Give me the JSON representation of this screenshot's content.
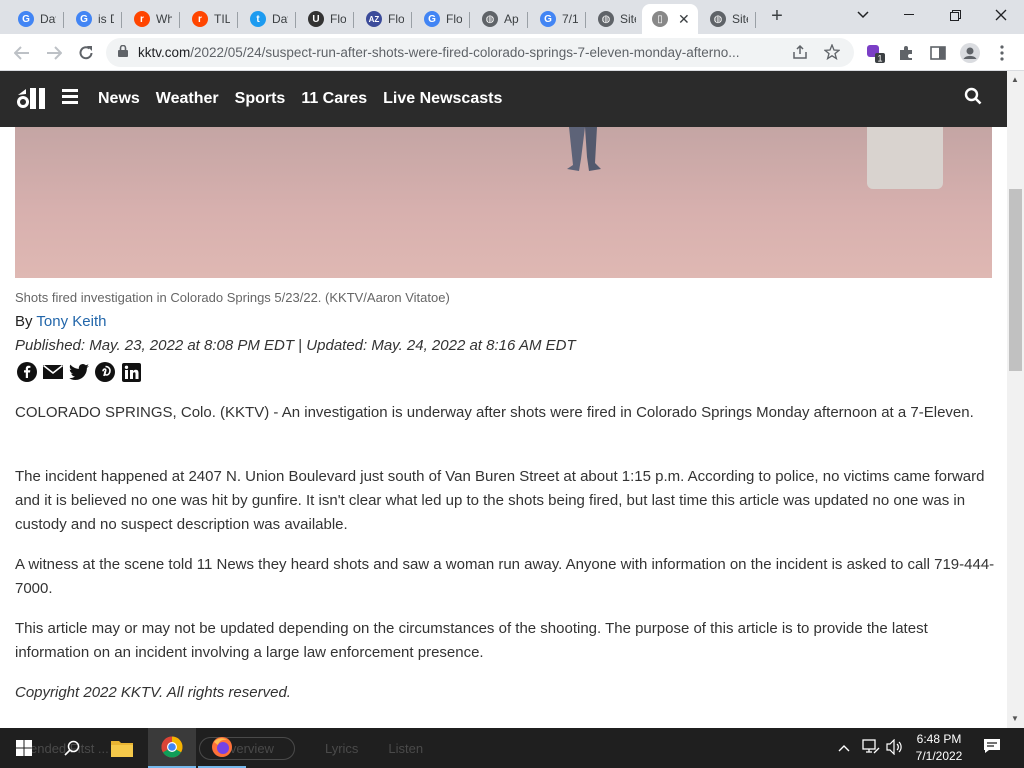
{
  "browser": {
    "tabs": [
      {
        "icon": "google-icon",
        "title": "Dav",
        "color": "#4285f4",
        "glyph": "G"
      },
      {
        "icon": "google-icon",
        "title": "is D",
        "color": "#4285f4",
        "glyph": "G"
      },
      {
        "icon": "reddit-icon",
        "title": "Wh",
        "color": "#ff4500",
        "glyph": "r"
      },
      {
        "icon": "reddit-icon",
        "title": "TIL",
        "color": "#ff4500",
        "glyph": "r"
      },
      {
        "icon": "twitter-icon",
        "title": "Dav",
        "color": "#1d9bf0",
        "glyph": "t"
      },
      {
        "icon": "flo-icon",
        "title": "Flo",
        "color": "#333333",
        "glyph": "U"
      },
      {
        "icon": "az-icon",
        "title": "Flo",
        "color": "#3b4b9a",
        "glyph": "AZ"
      },
      {
        "icon": "google-icon",
        "title": "Flo",
        "color": "#4285f4",
        "glyph": "G"
      },
      {
        "icon": "globe-icon",
        "title": "Ap",
        "color": "#5f6368",
        "glyph": "◍"
      },
      {
        "icon": "google-icon",
        "title": "7/1",
        "color": "#4285f4",
        "glyph": "G"
      },
      {
        "icon": "globe-icon",
        "title": "Site",
        "color": "#5f6368",
        "glyph": "◍"
      },
      {
        "icon": "kktv-icon",
        "title": "",
        "color": "#888888",
        "glyph": "▯",
        "active": true
      },
      {
        "icon": "globe-icon",
        "title": "Site",
        "color": "#5f6368",
        "glyph": "◍"
      }
    ],
    "new_tab_label": "+",
    "url_host": "kktv.com",
    "url_path": "/2022/05/24/suspect-run-after-shots-were-fired-colorado-springs-7-eleven-monday-afterno...",
    "extension_badge": "1"
  },
  "site": {
    "logo_text": "11",
    "nav": [
      "News",
      "Weather",
      "Sports",
      "11 Cares",
      "Live Newscasts"
    ]
  },
  "article": {
    "caption": "Shots fired investigation in Colorado Springs 5/23/22.  (KKTV/Aaron Vitatoe)",
    "by_prefix": "By ",
    "author": "Tony Keith",
    "published": "Published: May. 23, 2022 at 8:08 PM EDT",
    "separator": "|",
    "updated": "Updated: May. 24, 2022 at 8:16 AM EDT",
    "share": [
      "facebook-icon",
      "email-icon",
      "twitter-icon",
      "pinterest-icon",
      "linkedin-icon"
    ],
    "paragraphs": [
      "COLORADO SPRINGS, Colo. (KKTV) - An investigation is underway after shots were fired in Colorado Springs Monday afternoon at a 7-Eleven.",
      "The incident happened at 2407 N. Union Boulevard just south of Van Buren Street at about 1:15 p.m. According to police, no victims came forward and it is believed no one was hit by gunfire. It isn't clear what led up to the shots being fired, but last time this article was updated no one was in custody and no suspect description was available.",
      "A witness at the scene told 11 News they heard shots and saw a woman run away. Anyone with information on the incident is asked to call 719-444-7000.",
      "This article may or may not be updated depending on the circumstances of the shooting. The purpose of this article is to provide the latest information on an incident involving a large law enforcement presence."
    ],
    "copyright": "Copyright 2022 KKTV. All rights reserved."
  },
  "taskbar": {
    "ghost_text": [
      "ended Fitst ...",
      "Overview",
      "Lyrics",
      "Listen"
    ],
    "time": "6:48 PM",
    "date": "7/1/2022"
  }
}
